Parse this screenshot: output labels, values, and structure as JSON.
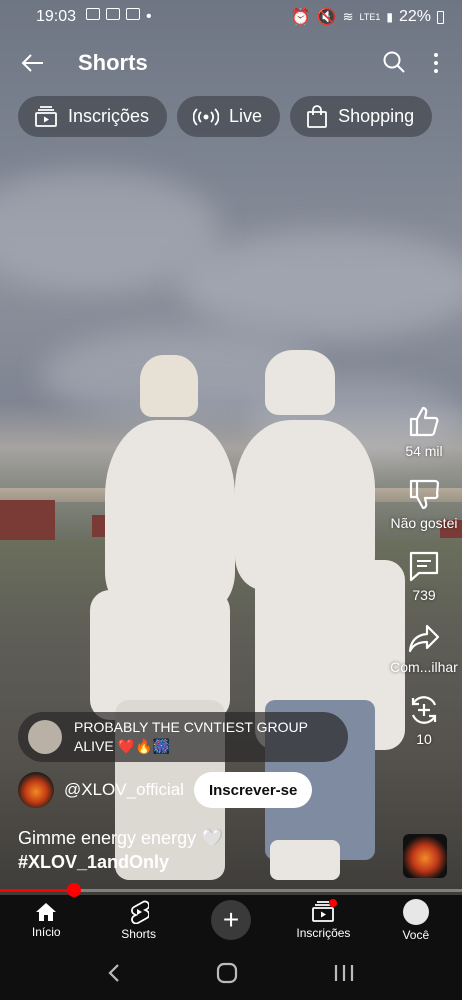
{
  "status_bar": {
    "time": "19:03",
    "battery": "22%",
    "network": "LTE1"
  },
  "header": {
    "title": "Shorts"
  },
  "chips": [
    {
      "label": "Inscrições",
      "icon": "subscriptions-icon"
    },
    {
      "label": "Live",
      "icon": "live-icon"
    },
    {
      "label": "Shopping",
      "icon": "shopping-bag-icon"
    }
  ],
  "actions": {
    "like_count": "54 mil",
    "dislike_label": "Não gostei",
    "comment_count": "739",
    "share_label": "Com...ilhar",
    "remix_count": "10"
  },
  "comment": {
    "line1": "PROBABLY THE CVNTIEST GROUP",
    "line2": "ALIVE ❤️🔥🎆"
  },
  "channel": {
    "handle": "@XLOV_official",
    "subscribe_label": "Inscrever-se"
  },
  "caption": {
    "text": "Gimme energy energy 🤍",
    "hashtag": "#XLOV_1andOnly"
  },
  "playback": {
    "progress": 0.16
  },
  "nav": {
    "home": "Início",
    "shorts": "Shorts",
    "subscriptions": "Inscrições",
    "you": "Você"
  },
  "colors": {
    "accent": "#ff0000",
    "nav_bg": "#0f0f0f",
    "chip_bg": "#464a52"
  }
}
